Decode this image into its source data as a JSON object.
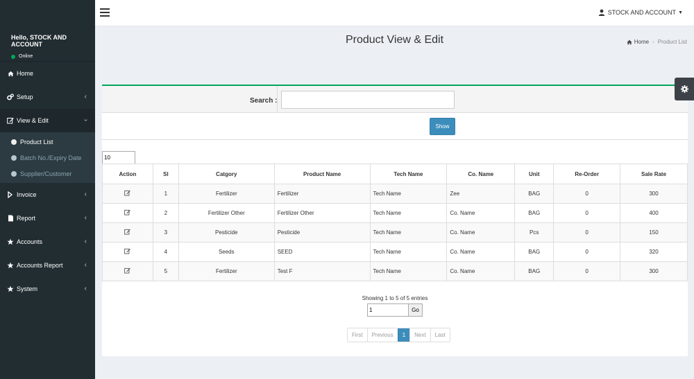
{
  "sidebar": {
    "greeting": "Hello, STOCK AND ACCOUNT",
    "status": "Online",
    "items": [
      {
        "label": "Home",
        "icon": "home-icon"
      },
      {
        "label": "Setup",
        "icon": "cogs-icon"
      },
      {
        "label": "View & Edit",
        "icon": "edit-icon"
      },
      {
        "label": "Invoice",
        "icon": "invoice-icon"
      },
      {
        "label": "Report",
        "icon": "file-icon"
      },
      {
        "label": "Accounts",
        "icon": "star-icon"
      },
      {
        "label": "Accounts Report",
        "icon": "star-icon"
      },
      {
        "label": "System",
        "icon": "star-icon"
      }
    ],
    "submenu": [
      {
        "label": "Product List"
      },
      {
        "label": "Batch No./Expiry Date"
      },
      {
        "label": "Supplier/Customer"
      }
    ]
  },
  "topbar": {
    "user": "STOCK AND ACCOUNT"
  },
  "page": {
    "title": "Product View & Edit",
    "breadcrumb_home": "Home",
    "breadcrumb_current": "Product List"
  },
  "search": {
    "label": "Search :",
    "value": "",
    "show_label": "Show"
  },
  "table": {
    "page_length": "10",
    "headers": [
      "Action",
      "Sl",
      "Catgory",
      "Product Name",
      "Tech Name",
      "Co. Name",
      "Unit",
      "Re-Order",
      "Sale Rate"
    ],
    "rows": [
      {
        "sl": "1",
        "category": "Fertilizer",
        "product": "Fertilizer",
        "tech": "Tech Name",
        "co": "Zee",
        "unit": "BAG",
        "reorder": "0",
        "rate": "300"
      },
      {
        "sl": "2",
        "category": "Fertilizer Other",
        "product": "Fertilizer Other",
        "tech": "Tech Name",
        "co": "Co. Name",
        "unit": "BAG",
        "reorder": "0",
        "rate": "400"
      },
      {
        "sl": "3",
        "category": "Pesticide",
        "product": "Pesticide",
        "tech": "Tech Name",
        "co": "Co. Name",
        "unit": "Pcs",
        "reorder": "0",
        "rate": "150"
      },
      {
        "sl": "4",
        "category": "Seeds",
        "product": "SEED",
        "tech": "Tech Name",
        "co": "Co. Name",
        "unit": "BAG",
        "reorder": "0",
        "rate": "320"
      },
      {
        "sl": "5",
        "category": "Fertilizer",
        "product": "Test F",
        "tech": "Tech Name",
        "co": "Co. Name",
        "unit": "BAG",
        "reorder": "0",
        "rate": "300"
      }
    ],
    "info": "Showing 1 to 5 of 5 entries",
    "goto_value": "1",
    "go_label": "Go"
  },
  "pager": {
    "first": "First",
    "previous": "Previous",
    "current": "1",
    "next": "Next",
    "last": "Last"
  },
  "colors": {
    "sidebar_bg": "#222d32",
    "accent": "#3c8dbc",
    "box_border": "#00a65a",
    "online": "#00a65a"
  }
}
